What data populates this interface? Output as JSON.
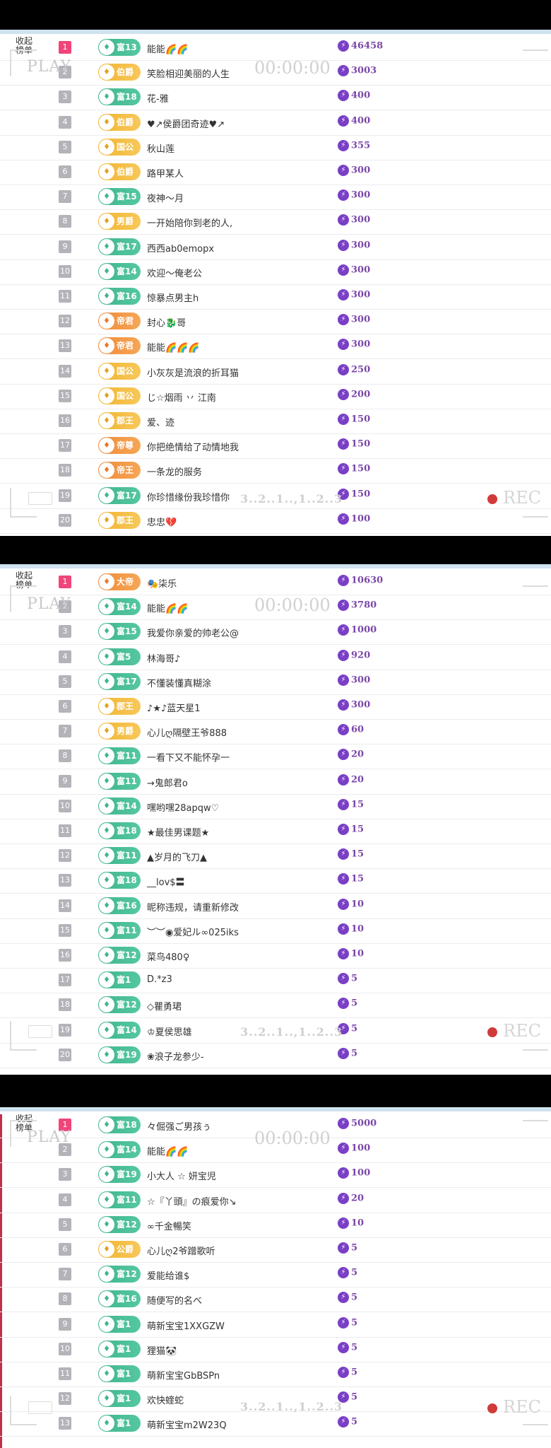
{
  "collapse_label": "收起\n榜单",
  "overlay": {
    "play": "PLAY",
    "time": "00:00:00",
    "countdown": "3..2..1..,1..2..3",
    "rec": "REC"
  },
  "panels": [
    {
      "rows": [
        {
          "rank": "1",
          "badge": "富13",
          "color": "green",
          "name": "能能🌈🌈",
          "score": "46458"
        },
        {
          "rank": "2",
          "badge": "伯爵",
          "color": "gold",
          "name": "笑脸相迎美丽的人生",
          "score": "3003"
        },
        {
          "rank": "3",
          "badge": "富18",
          "color": "green",
          "name": "花-雅",
          "score": "400"
        },
        {
          "rank": "4",
          "badge": "伯爵",
          "color": "gold",
          "name": "♥↗侯爵团奇迹♥↗",
          "score": "400"
        },
        {
          "rank": "5",
          "badge": "国公",
          "color": "gold",
          "name": "秋山莲",
          "score": "355"
        },
        {
          "rank": "6",
          "badge": "伯爵",
          "color": "gold",
          "name": "路甲某人",
          "score": "300"
        },
        {
          "rank": "7",
          "badge": "富15",
          "color": "green",
          "name": "夜神～月",
          "score": "300"
        },
        {
          "rank": "8",
          "badge": "男爵",
          "color": "gold",
          "name": "一开始陪你到老的人,",
          "score": "300"
        },
        {
          "rank": "9",
          "badge": "富17",
          "color": "green",
          "name": "西西ab0emopx",
          "score": "300"
        },
        {
          "rank": "10",
          "badge": "富14",
          "color": "green",
          "name": "欢迎～俺老公",
          "score": "300"
        },
        {
          "rank": "11",
          "badge": "富16",
          "color": "green",
          "name": "惊暴点男主h",
          "score": "300"
        },
        {
          "rank": "12",
          "badge": "帝君",
          "color": "orange",
          "name": "封心🐉哥",
          "score": "300"
        },
        {
          "rank": "13",
          "badge": "帝君",
          "color": "orange",
          "name": "能能🌈🌈🌈",
          "score": "300"
        },
        {
          "rank": "14",
          "badge": "国公",
          "color": "gold",
          "name": "小灰灰是流浪的折耳猫",
          "score": "250"
        },
        {
          "rank": "15",
          "badge": "国公",
          "color": "gold",
          "name": "じ☆烟雨 丷 江南",
          "score": "200"
        },
        {
          "rank": "16",
          "badge": "郡王",
          "color": "gold",
          "name": "爱、迹",
          "score": "150"
        },
        {
          "rank": "17",
          "badge": "帝尊",
          "color": "orange",
          "name": "你把绝情给了动情地我",
          "score": "150"
        },
        {
          "rank": "18",
          "badge": "帝王",
          "color": "orange",
          "name": "一条龙的服务",
          "score": "150"
        },
        {
          "rank": "19",
          "badge": "富17",
          "color": "green",
          "name": "你珍惜缘份我珍惜你",
          "score": "150"
        },
        {
          "rank": "20",
          "badge": "郡王",
          "color": "gold",
          "name": "忠忠💔",
          "score": "100"
        }
      ]
    },
    {
      "rows": [
        {
          "rank": "1",
          "badge": "大帝",
          "color": "orange",
          "name": "🎭柒乐",
          "score": "10630"
        },
        {
          "rank": "2",
          "badge": "富14",
          "color": "green",
          "name": "能能🌈🌈",
          "score": "3780"
        },
        {
          "rank": "3",
          "badge": "富15",
          "color": "green",
          "name": "我爱你亲爱的帅老公@",
          "score": "1000"
        },
        {
          "rank": "4",
          "badge": "富5",
          "color": "green",
          "name": "林海哥♪",
          "score": "920"
        },
        {
          "rank": "5",
          "badge": "富17",
          "color": "green",
          "name": "不懂装懂真糊涂",
          "score": "300"
        },
        {
          "rank": "6",
          "badge": "郡王",
          "color": "gold",
          "name": "♪★♪蓝天星1",
          "score": "300"
        },
        {
          "rank": "7",
          "badge": "男爵",
          "color": "gold",
          "name": "心儿ღ隔壁王爷888",
          "score": "60"
        },
        {
          "rank": "8",
          "badge": "富11",
          "color": "green",
          "name": "一看下又不能怀孕一",
          "score": "20"
        },
        {
          "rank": "9",
          "badge": "富11",
          "color": "green",
          "name": "→鬼郎君o",
          "score": "20"
        },
        {
          "rank": "10",
          "badge": "富14",
          "color": "green",
          "name": "嘿哟嘿28apqw♡",
          "score": "15"
        },
        {
          "rank": "11",
          "badge": "富18",
          "color": "green",
          "name": "★最佳男课题★",
          "score": "15"
        },
        {
          "rank": "12",
          "badge": "富11",
          "color": "green",
          "name": "▲岁月的飞刀▲",
          "score": "15"
        },
        {
          "rank": "13",
          "badge": "富18",
          "color": "green",
          "name": "__lov$〓",
          "score": "15"
        },
        {
          "rank": "14",
          "badge": "富16",
          "color": "green",
          "name": "昵称违规，请重新修改",
          "score": "10"
        },
        {
          "rank": "15",
          "badge": "富11",
          "color": "green",
          "name": "︶︶◉爱妃ル∞025iks",
          "score": "10"
        },
        {
          "rank": "16",
          "badge": "富12",
          "color": "green",
          "name": "菜鸟480♀",
          "score": "10"
        },
        {
          "rank": "17",
          "badge": "富1",
          "color": "green",
          "name": "D.*z3",
          "score": "5"
        },
        {
          "rank": "18",
          "badge": "富12",
          "color": "green",
          "name": "◇瞿勇珺",
          "score": "5"
        },
        {
          "rank": "19",
          "badge": "富14",
          "color": "green",
          "name": "♔夏侯思雄",
          "score": "5"
        },
        {
          "rank": "20",
          "badge": "富19",
          "color": "green",
          "name": "❀浪子龙参少-",
          "score": "5"
        }
      ]
    },
    {
      "rows": [
        {
          "rank": "1",
          "badge": "富18",
          "color": "green",
          "name": "々倔强ご男孩ぅ",
          "score": "5000"
        },
        {
          "rank": "2",
          "badge": "富14",
          "color": "green",
          "name": "能能🌈🌈",
          "score": "100"
        },
        {
          "rank": "3",
          "badge": "富19",
          "color": "green",
          "name": "小大人 ☆ 妍宝児",
          "score": "100"
        },
        {
          "rank": "4",
          "badge": "富11",
          "color": "green",
          "name": "☆『丫頭』の痕爱你↘",
          "score": "20"
        },
        {
          "rank": "5",
          "badge": "富12",
          "color": "green",
          "name": "∞千金暢笑",
          "score": "10"
        },
        {
          "rank": "6",
          "badge": "公爵",
          "color": "gold",
          "name": "心儿ღ2爷蹭歌听",
          "score": "5"
        },
        {
          "rank": "7",
          "badge": "富12",
          "color": "green",
          "name": "爱能给谁$",
          "score": "5"
        },
        {
          "rank": "8",
          "badge": "富16",
          "color": "green",
          "name": "随便写的名べ",
          "score": "5"
        },
        {
          "rank": "9",
          "badge": "富1",
          "color": "green",
          "name": "萌新宝宝1XXGZW",
          "score": "5"
        },
        {
          "rank": "10",
          "badge": "富1",
          "color": "green",
          "name": "狸猫🐼",
          "score": "5"
        },
        {
          "rank": "11",
          "badge": "富1",
          "color": "green",
          "name": "萌新宝宝GbBSPn",
          "score": "5"
        },
        {
          "rank": "12",
          "badge": "富1",
          "color": "green",
          "name": "欢快蝰蛇",
          "score": "5"
        },
        {
          "rank": "13",
          "badge": "富1",
          "color": "green",
          "name": "萌新宝宝m2W23Q",
          "score": "5"
        }
      ]
    }
  ]
}
